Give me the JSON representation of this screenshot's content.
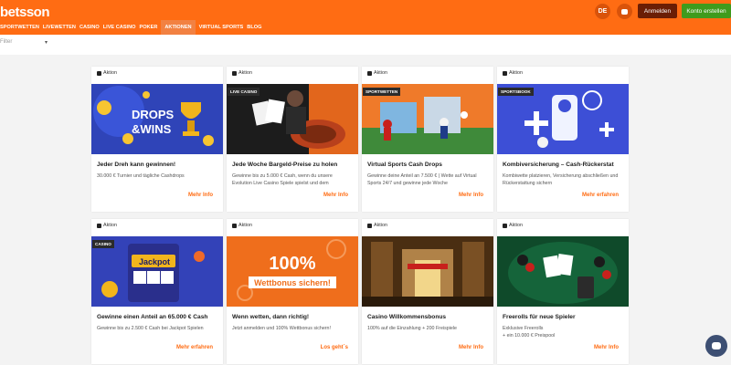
{
  "header": {
    "logo": "betsson",
    "lang": "DE",
    "login_label": "Anmelden",
    "register_label": "Konto erstellen",
    "nav": [
      "SPORTWETTEN",
      "LIVEWETTEN",
      "CASINO",
      "LIVE CASINO",
      "POKER",
      "AKTIONEN",
      "VIRTUAL SPORTS",
      "BLOG"
    ],
    "active_nav": "AKTIONEN"
  },
  "filter": {
    "label": "Filter"
  },
  "cards": [
    {
      "tag": "Aktion",
      "badge": "",
      "title": "Jeder Dreh kann gewinnen!",
      "desc": "30.000 € Turnier und tägliche Cashdrops",
      "link": "Mehr Info",
      "image": "drops-and-wins"
    },
    {
      "tag": "Aktion",
      "badge": "LIVE CASINO",
      "title": "Jede Woche Bargeld-Preise zu holen",
      "desc": "Gewinne bis zu 5.000 € Cash, wenn du unsere Evolution Live Casino Spiele spielst und dem",
      "link": "Mehr Info",
      "image": "live-casino"
    },
    {
      "tag": "Aktion",
      "badge": "SPORTWETTEN",
      "title": "Virtual Sports Cash Drops",
      "desc": "Gewinne deine Anteil an 7.500 € | Wette auf Virtual Sports 24/7 und gewinne jede Woche",
      "link": "Mehr Info",
      "image": "virtual-sports"
    },
    {
      "tag": "Aktion",
      "badge": "SPORTSBOOK",
      "title": "Kombiversicherung – Cash-Rückerstat",
      "desc": "Kombiwette platzieren, Versicherung abschließen und Rückerstattung sichern",
      "link": "Mehr erfahren",
      "image": "sportsbook"
    },
    {
      "tag": "Aktion",
      "badge": "CASINO",
      "title": "Gewinne einen Anteil an 65.000 € Cash",
      "desc": "Gewinne bis zu 2.500 € Cash bei Jackpot Spielen",
      "link": "Mehr erfahren",
      "image": "jackpot"
    },
    {
      "tag": "Aktion",
      "badge": "",
      "title": "Wenn wetten, dann richtig!",
      "desc": "Jetzt anmelden und 100% Wettbonus sichern!",
      "link": "Los geht´s",
      "image": "wettbonus",
      "img_text_big": "100%",
      "img_text_small": "Wettbonus sichern!"
    },
    {
      "tag": "Aktion",
      "badge": "",
      "title": "Casino Willkommensbonus",
      "desc": "100% auf die Einzahlung + 200 Freispiele",
      "link": "Mehr Info",
      "image": "temple"
    },
    {
      "tag": "Aktion",
      "badge": "",
      "title": "Freerolls für neue Spieler",
      "desc": "Exklusive Freerolls\n+ ein 10.000 € Preispool",
      "link": "Mehr Info",
      "image": "poker"
    }
  ]
}
